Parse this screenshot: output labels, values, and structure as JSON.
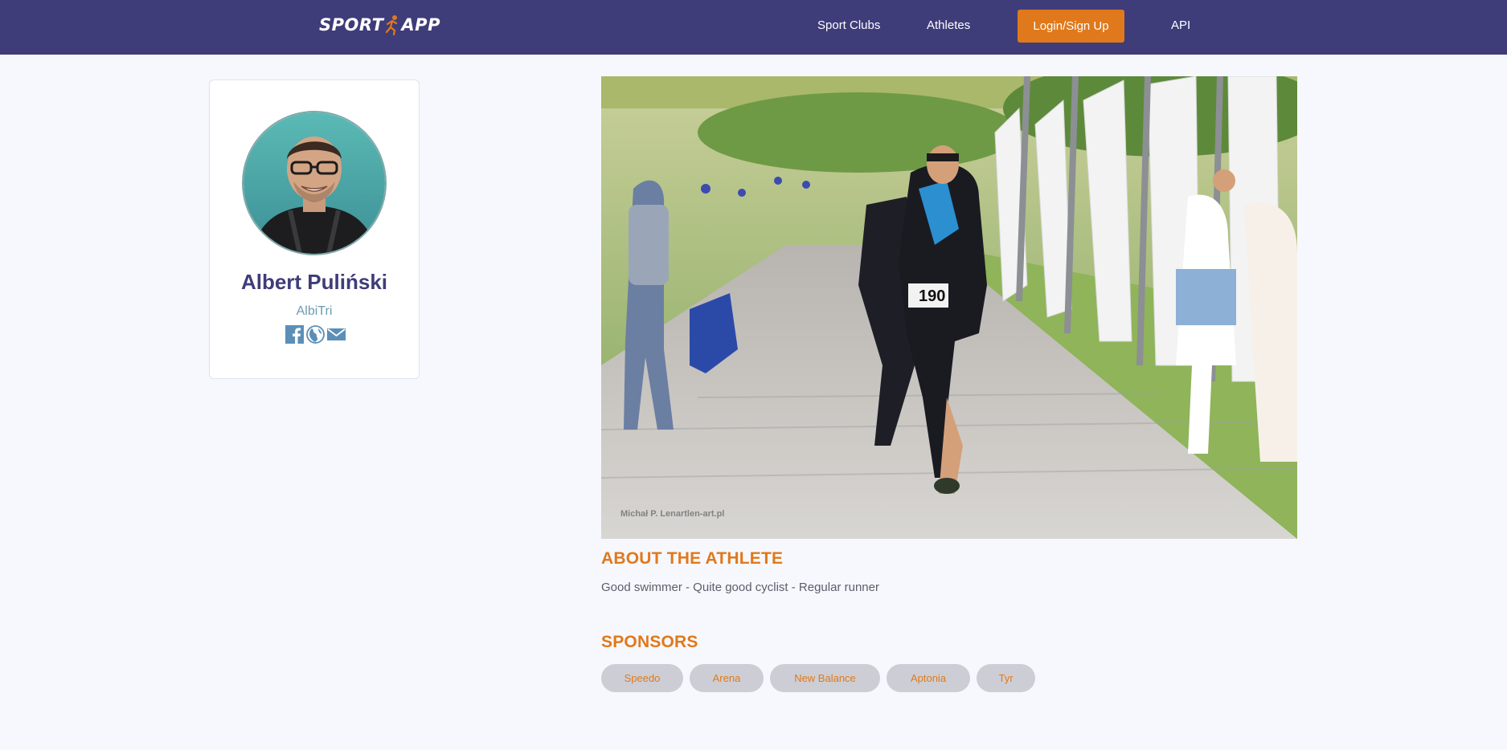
{
  "navbar": {
    "logo_left": "SPORT",
    "logo_right": "APP",
    "links": {
      "sport_clubs": "Sport Clubs",
      "athletes": "Athletes",
      "login": "Login/Sign Up",
      "api": "API"
    },
    "login_color": "#e0791b",
    "bg_color": "#3f3c7a"
  },
  "profile": {
    "name": "Albert Puliński",
    "nickname": "AlbiTri",
    "social_icons": [
      "facebook-icon",
      "globe-icon",
      "email-icon"
    ]
  },
  "about": {
    "title": "ABOUT THE ATHLETE",
    "text": "Good swimmer - Quite good cyclist - Regular runner"
  },
  "sponsors": {
    "title": "SPONSORS",
    "items": [
      "Speedo",
      "Arena",
      "New Balance",
      "Aptonia",
      "Tyr"
    ]
  },
  "hero": {
    "bib_number": "190",
    "watermark": "Michał P. Lenartlen-art.pl"
  }
}
